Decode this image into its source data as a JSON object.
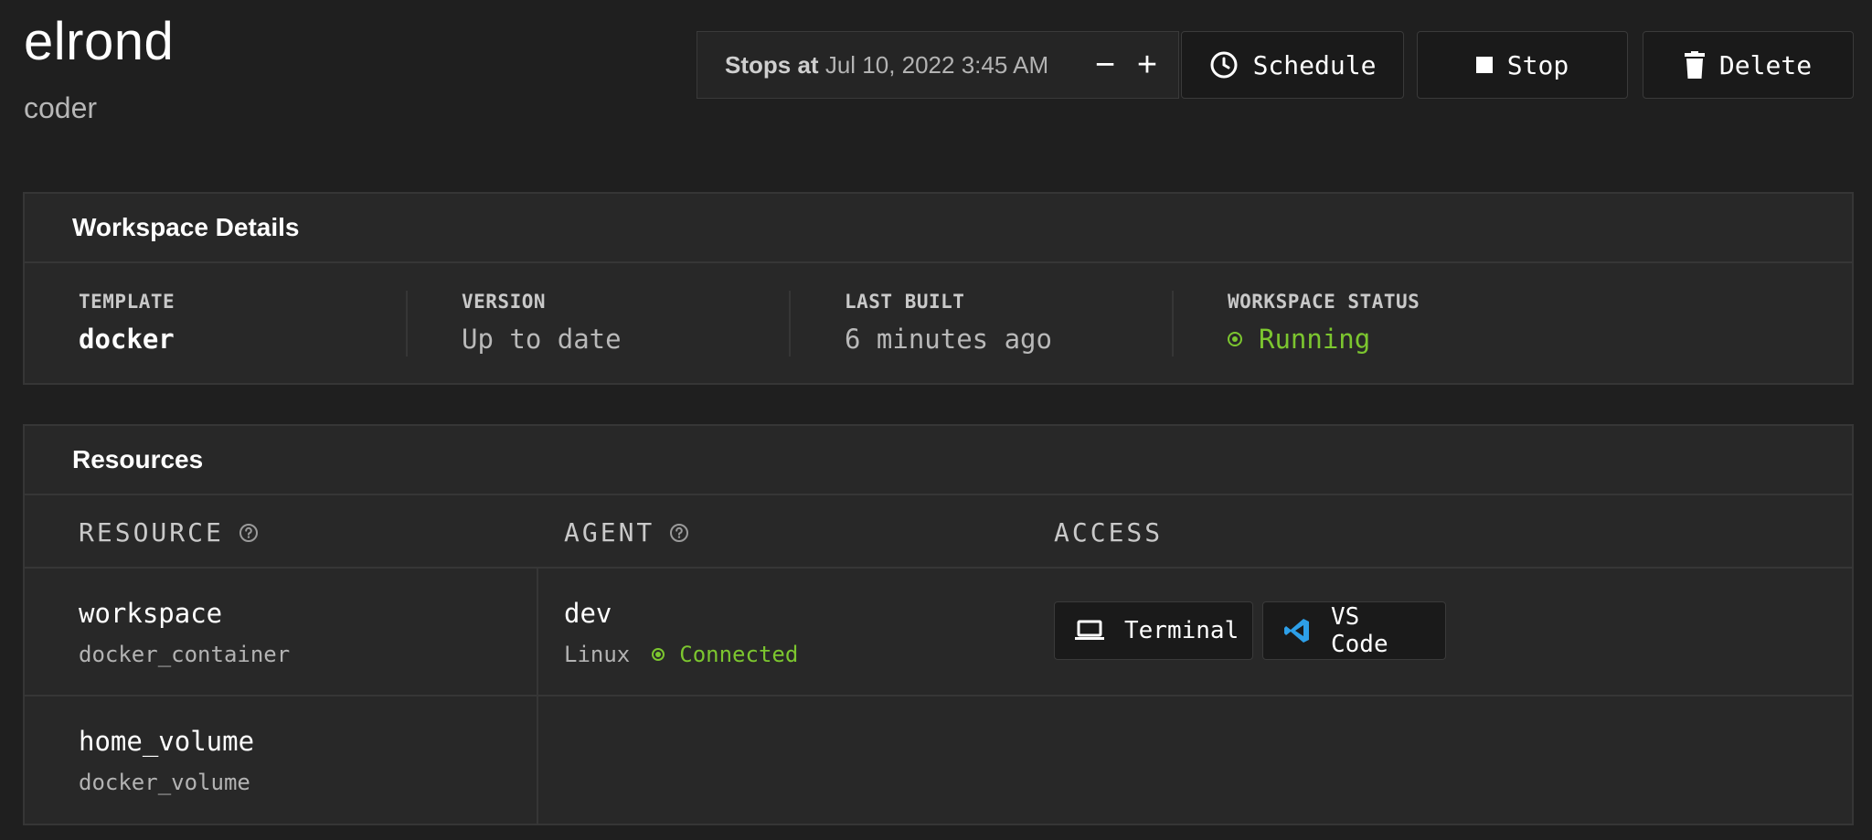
{
  "workspace": {
    "name": "elrond",
    "owner": "coder"
  },
  "schedule": {
    "stops_label": "Stops at",
    "stops_value": "Jul 10, 2022 3:45 AM",
    "decrease_label": "−",
    "increase_label": "+"
  },
  "actions": {
    "schedule_label": "Schedule",
    "stop_label": "Stop",
    "delete_label": "Delete"
  },
  "details": {
    "title": "Workspace Details",
    "items": [
      {
        "label": "TEMPLATE",
        "value": "docker"
      },
      {
        "label": "VERSION",
        "value": "Up to date"
      },
      {
        "label": "LAST BUILT",
        "value": "6 minutes ago"
      },
      {
        "label": "WORKSPACE STATUS",
        "value": "Running"
      }
    ]
  },
  "resources": {
    "title": "Resources",
    "headers": {
      "resource": "RESOURCE",
      "agent": "AGENT",
      "access": "ACCESS"
    },
    "rows": [
      {
        "name": "workspace",
        "type": "docker_container",
        "agent": {
          "name": "dev",
          "os": "Linux",
          "status": "Connected"
        }
      },
      {
        "name": "home_volume",
        "type": "docker_volume"
      }
    ],
    "access": {
      "terminal_label": "Terminal",
      "vscode_label": "VS Code"
    }
  },
  "colors": {
    "background": "#1f1f1f",
    "card": "#282828",
    "border": "#363636",
    "status_ok": "#7cc62f",
    "vscode_blue": "#2d9fe8"
  },
  "icons": [
    "clock-icon",
    "stop-icon",
    "trash-icon",
    "help-icon",
    "laptop-icon",
    "vscode-icon",
    "status-dot-icon"
  ]
}
